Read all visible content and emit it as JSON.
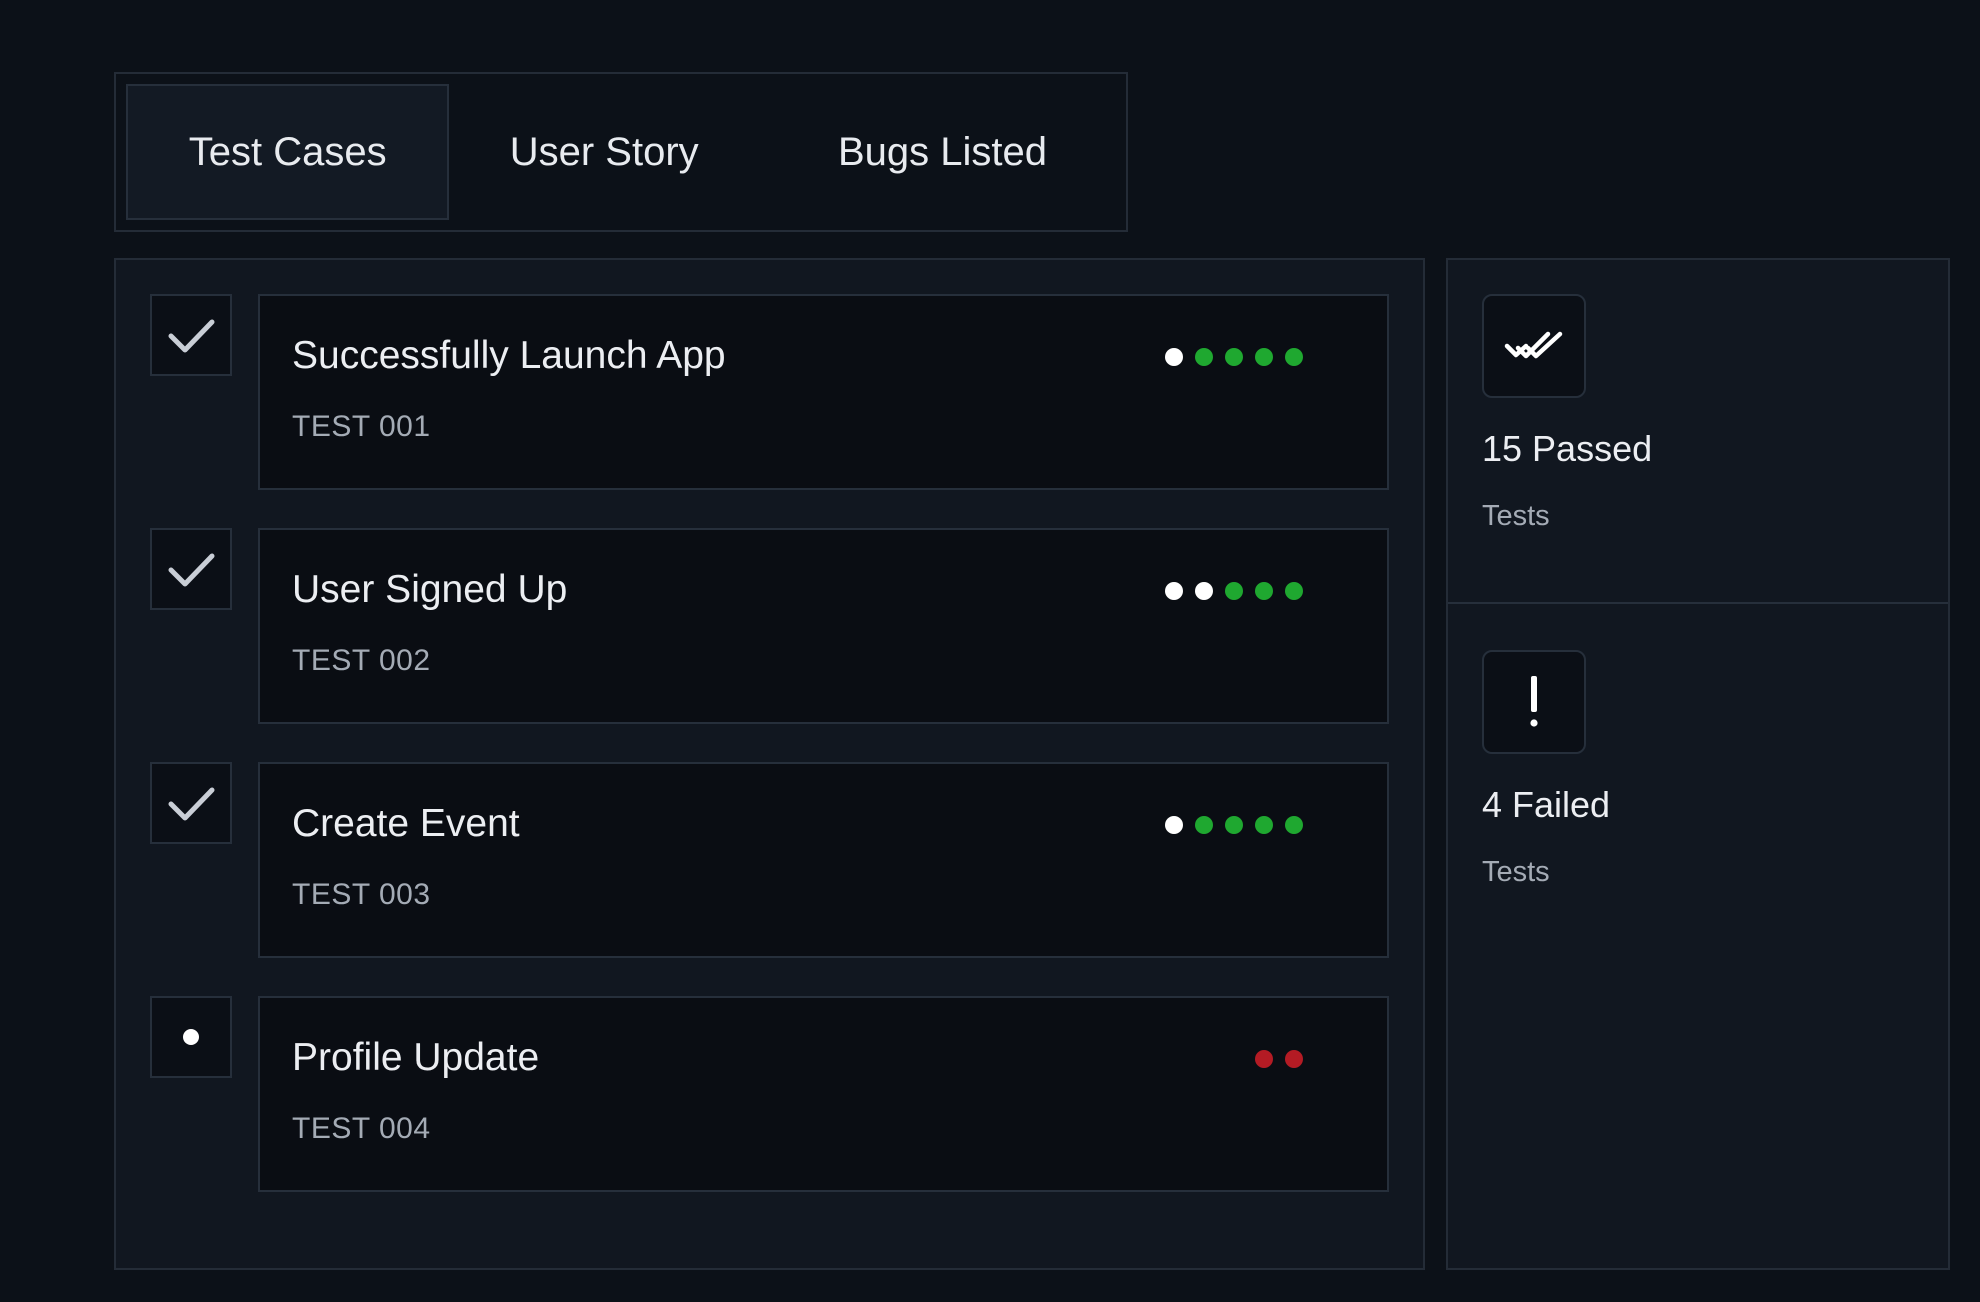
{
  "tabs": [
    {
      "label": "Test Cases",
      "active": true
    },
    {
      "label": "User Story",
      "active": false
    },
    {
      "label": "Bugs Listed",
      "active": false
    }
  ],
  "colors": {
    "pass": "#1fa830",
    "fail": "#b41b24",
    "pending": "#ffffff"
  },
  "tests": [
    {
      "title": "Successfully Launch App",
      "id": "TEST 001",
      "checkbox": "check-icon",
      "dots": [
        "pending",
        "pass",
        "pass",
        "pass",
        "pass"
      ]
    },
    {
      "title": "User Signed Up",
      "id": "TEST 002",
      "checkbox": "check-icon",
      "dots": [
        "pending",
        "pending",
        "pass",
        "pass",
        "pass"
      ]
    },
    {
      "title": "Create Event",
      "id": "TEST 003",
      "checkbox": "check-icon",
      "dots": [
        "pending",
        "pass",
        "pass",
        "pass",
        "pass"
      ]
    },
    {
      "title": "Profile Update",
      "id": "TEST 004",
      "checkbox": "dot-icon",
      "dots": [
        "fail",
        "fail"
      ]
    }
  ],
  "stats": [
    {
      "icon": "double-check-icon",
      "value": "15 Passed",
      "label": "Tests"
    },
    {
      "icon": "exclamation-icon",
      "value": "4 Failed",
      "label": "Tests"
    }
  ]
}
